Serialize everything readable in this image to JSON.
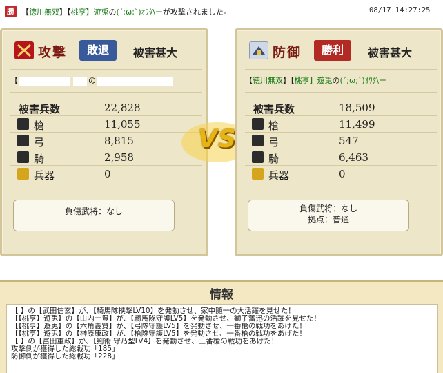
{
  "header": {
    "badge": "勝",
    "parts": [
      "【",
      "徳川無双",
      "】",
      "【",
      "桃亨】遊兎",
      "の",
      "(´;ω;`)ｵﾜﾀ\\ー",
      "が攻撃されました。"
    ],
    "date": "08/17 14:27:25"
  },
  "attack": {
    "label": "攻撃",
    "result": "敗退",
    "damage": "被害甚大",
    "names_open": "【",
    "names_no": "の",
    "total_label": "被害兵数",
    "total": "22,828",
    "units": [
      {
        "label": "槍",
        "value": "11,055",
        "icon": "spear-icon"
      },
      {
        "label": "弓",
        "value": "8,815",
        "icon": "bow-icon"
      },
      {
        "label": "騎",
        "value": "2,958",
        "icon": "horse-icon"
      },
      {
        "label": "兵器",
        "value": "0",
        "icon": "weapon-icon"
      }
    ],
    "injury": "負傷武将：なし"
  },
  "defend": {
    "label": "防御",
    "result": "勝利",
    "damage": "被害甚大",
    "names": [
      "【",
      "徳川無双",
      "】",
      "【",
      "桃亨】遊兎",
      "の",
      "(´;ω;`)ｵﾜﾀ\\ー"
    ],
    "total_label": "被害兵数",
    "total": "18,509",
    "units": [
      {
        "label": "槍",
        "value": "11,499",
        "icon": "spear-icon"
      },
      {
        "label": "弓",
        "value": "547",
        "icon": "bow-icon"
      },
      {
        "label": "騎",
        "value": "6,463",
        "icon": "horse-icon"
      },
      {
        "label": "兵器",
        "value": "0",
        "icon": "weapon-icon"
      }
    ],
    "injury": "負傷武将：なし",
    "base": "拠点：普通"
  },
  "vs_label": "VS",
  "info": {
    "title": "情報",
    "lines": [
      "【              】の【武田信玄】が、【騎馬隊挟撃LV10】を発動させ、家中随一の大活躍を見せた！",
      "【【桃亨】遊兎】の【山内一豊】が、【騎馬隊守護LV5】を発動させ、獅子奮迅の活躍を見せた！",
      "【【桃亨】遊兎】の【六角義賢】が、【弓隊守護LV5】を発動させ、一番槍の戦功をあげた！",
      "【【桃亨】遊兎】の【榊原康政】が、【槍隊守護LV5】を発動させ、一番槍の戦功をあげた！",
      "【              】の【富田重政】が、【剣術 守乃型LV4】を発動させ、三番槍の戦功をあげた！",
      "攻撃側が獲得した総戦功「185」",
      "防御側が獲得した総戦功「228」"
    ]
  },
  "colors": {
    "accent_red": "#b22a24",
    "accent_blue": "#38599a",
    "link_green": "#1a7d1a",
    "panel_bg": "#eee6c8",
    "info_bg": "#f4e8c2"
  }
}
